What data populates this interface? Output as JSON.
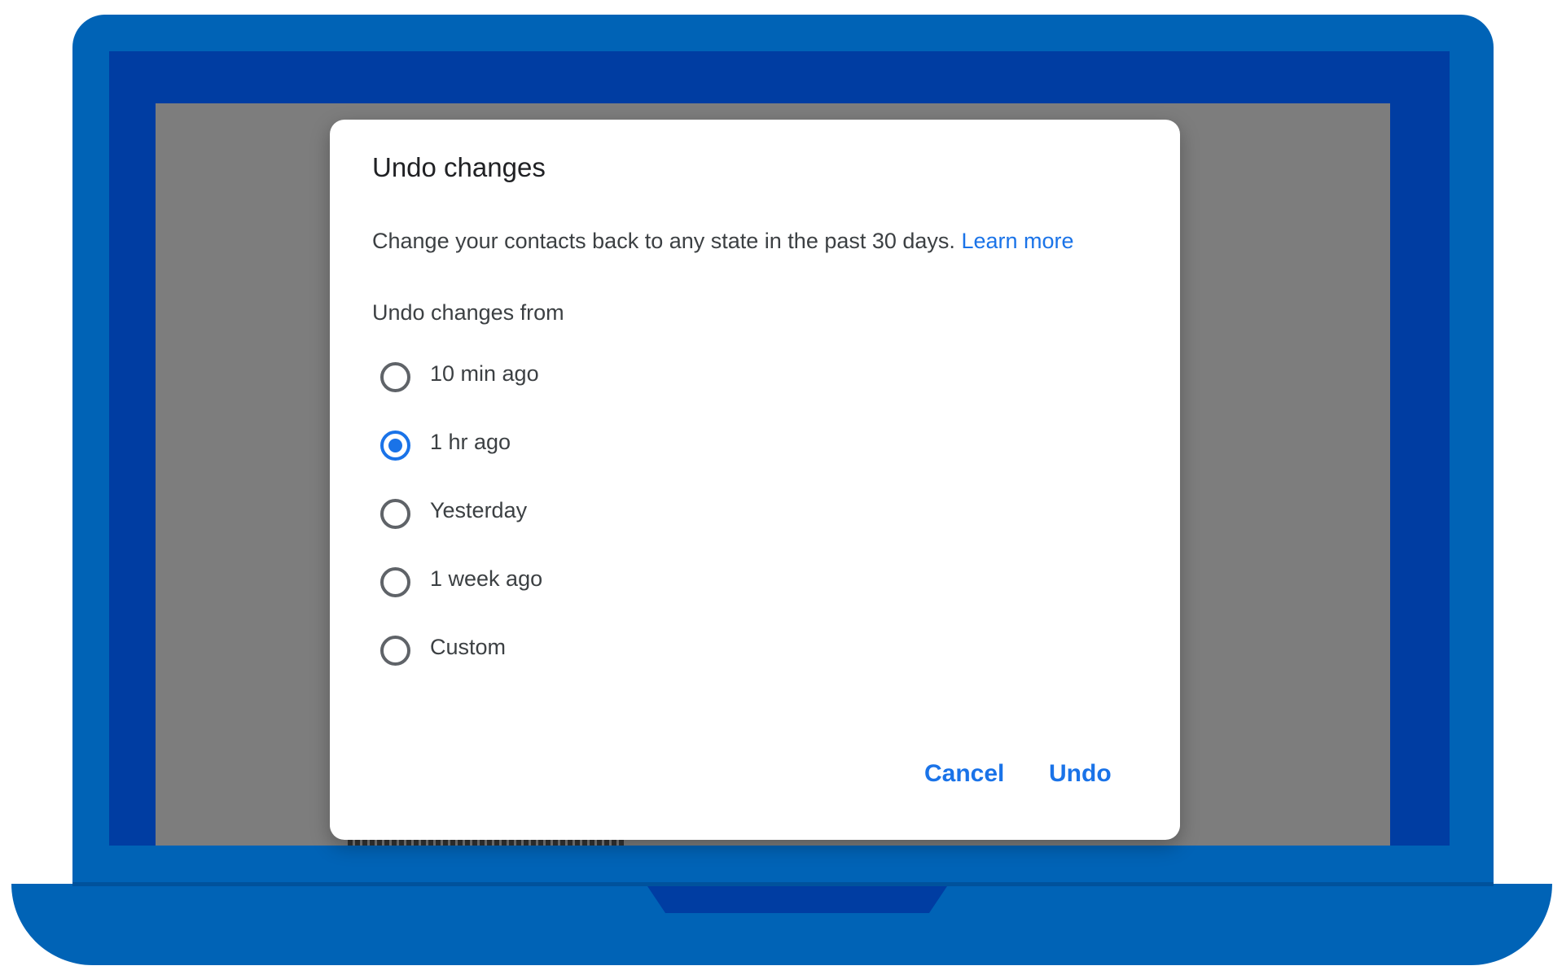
{
  "dialog": {
    "title": "Undo changes",
    "description": "Change your contacts back to any state in the past 30 days.",
    "learn_more": "Learn more",
    "undo_from_label": "Undo changes from",
    "options": [
      {
        "label": "10 min ago",
        "selected": false
      },
      {
        "label": "1 hr ago",
        "selected": true
      },
      {
        "label": "Yesterday",
        "selected": false
      },
      {
        "label": "1 week ago",
        "selected": false
      },
      {
        "label": "Custom",
        "selected": false
      }
    ],
    "cancel_label": "Cancel",
    "undo_label": "Undo"
  },
  "colors": {
    "accent": "#1a73e8",
    "laptop_body": "#0063b6",
    "laptop_bezel": "#003da2",
    "overlay": "#7d7d7d"
  }
}
